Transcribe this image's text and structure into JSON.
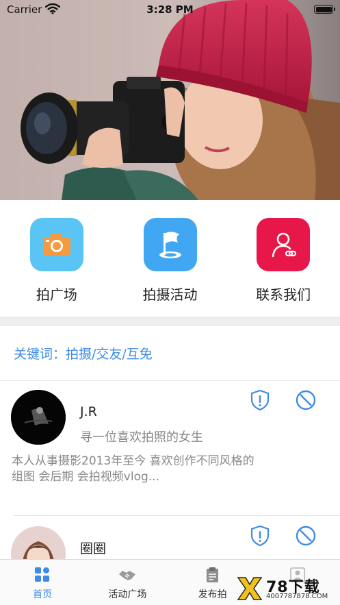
{
  "status_bar": {
    "carrier": "Carrier",
    "time": "3:28 PM"
  },
  "colors": {
    "accent": "#3d8be8",
    "plaza_icon_bg": "#5ac4f5",
    "event_icon_bg": "#41a7f2",
    "contact_icon_bg": "#e8174a"
  },
  "actions": [
    {
      "label": "拍广场",
      "icon": "camera-icon"
    },
    {
      "label": "拍摄活动",
      "icon": "flag-icon"
    },
    {
      "label": "联系我们",
      "icon": "contact-user-icon"
    }
  ],
  "keywords": "关键词：拍摄/交友/互免",
  "users": [
    {
      "name": "J.R",
      "tagline": "寻一位喜欢拍照的女生",
      "bio": "本人从事摄影2013年至今 喜欢创作不同风格的组图 会后期 会拍视频vlog..."
    },
    {
      "name": "圈圈"
    }
  ],
  "tabs": [
    {
      "label": "首页",
      "icon": "home-grid-icon",
      "active": true
    },
    {
      "label": "活动广场",
      "icon": "handshake-icon"
    },
    {
      "label": "发布拍",
      "icon": "publish-icon"
    },
    {
      "label": "",
      "icon": "profile-icon"
    }
  ],
  "watermark": {
    "brand": "78下载",
    "url": "4007787878.COM"
  }
}
